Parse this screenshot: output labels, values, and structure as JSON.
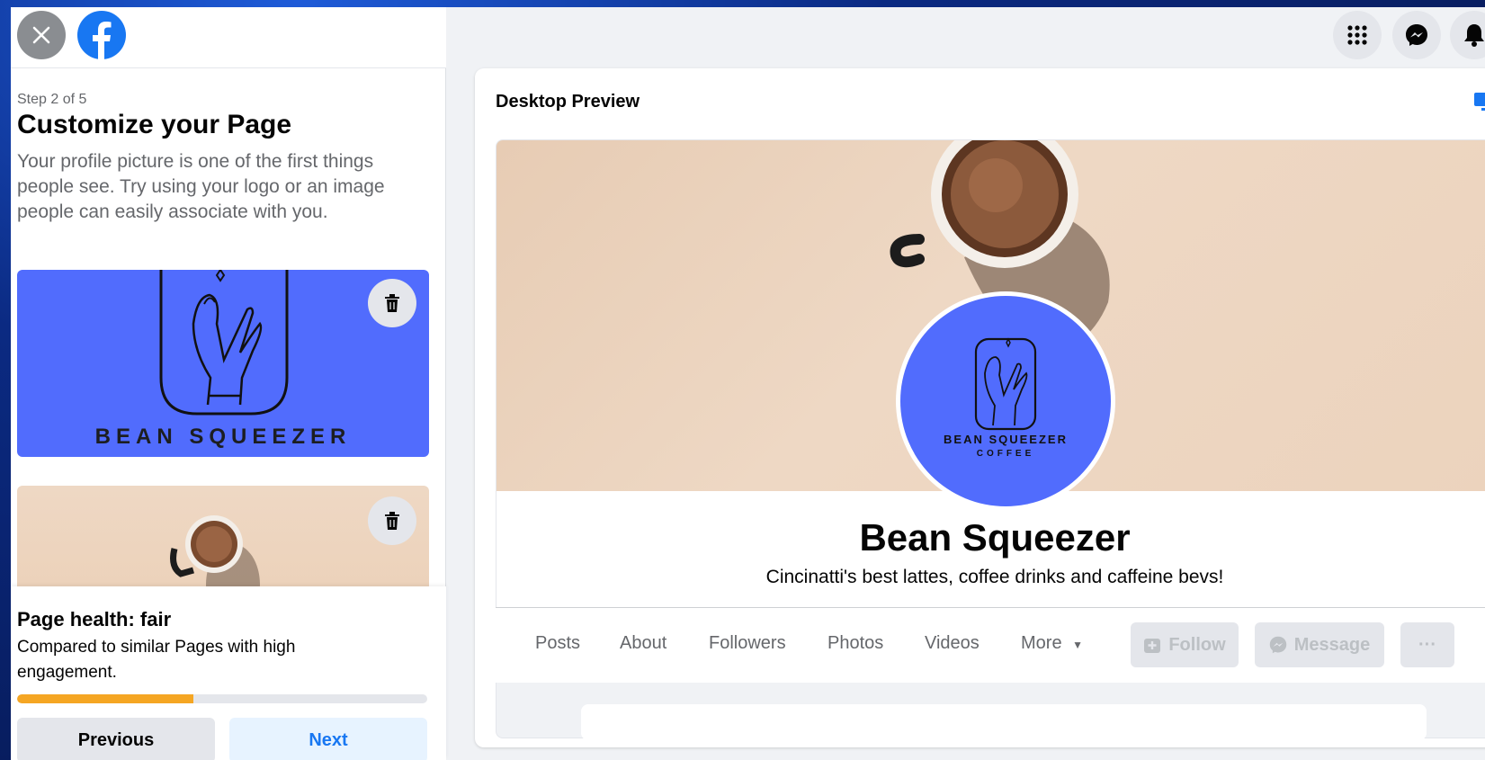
{
  "left_panel": {
    "step": "Step 2 of 5",
    "title": "Customize your Page",
    "description": "Your profile picture is one of the first things people see. Try using your logo or an image people can easily associate with you.",
    "logo_card_text": "BEAN SQUEEZER",
    "health_title": "Page health: fair",
    "health_desc": "Compared to similar Pages with high engagement.",
    "health_progress_fraction": 0.43,
    "health_color": "#f5a623",
    "previous_label": "Previous",
    "next_label": "Next"
  },
  "top_icons": [
    "apps-grid-icon",
    "messenger-icon",
    "notifications-bell-icon"
  ],
  "preview": {
    "label": "Desktop Preview",
    "avatar_text_line1": "BEAN SQUEEZER",
    "avatar_text_line2": "COFFEE",
    "page_name": "Bean Squeezer",
    "bio": "Cincinatti's best lattes, coffee drinks and caffeine bevs!",
    "tabs": [
      "Posts",
      "About",
      "Followers",
      "Photos",
      "Videos",
      "More"
    ],
    "follow_label": "Follow",
    "message_label": "Message",
    "more_actions_label": "···"
  },
  "colors": {
    "brand_blue": "#1877f2",
    "logo_blue": "#516cfd"
  }
}
